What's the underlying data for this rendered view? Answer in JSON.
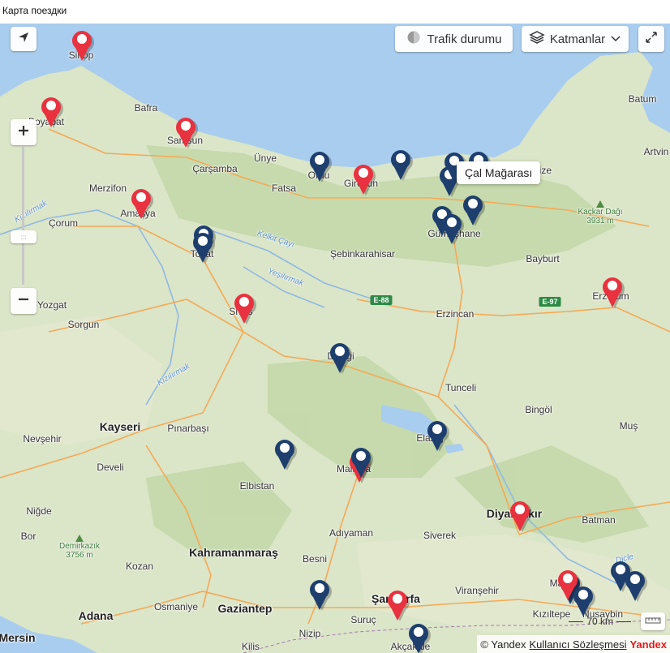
{
  "page": {
    "title": "Карта поездки"
  },
  "controls": {
    "traffic_label": "Trafik durumu",
    "layers_label": "Katmanlar",
    "scale_label": "70 km",
    "icons": [
      "navigate-arrow-icon",
      "traffic-icon",
      "layers-icon",
      "chevron-down-icon",
      "fullscreen-icon",
      "zoom-in-icon",
      "zoom-out-icon",
      "ruler-icon"
    ]
  },
  "tooltip": {
    "text": "Çal Mağarası"
  },
  "copyright": {
    "prefix": "© Yandex",
    "link": "Kullanıcı Sözleşmesi",
    "brand": "Yandex"
  },
  "cities": [
    {
      "name": "Sinop",
      "big": false
    },
    {
      "name": "Bafra",
      "big": false
    },
    {
      "name": "Boyabat",
      "big": false
    },
    {
      "name": "Samsun",
      "big": false
    },
    {
      "name": "Çarşamba",
      "big": false
    },
    {
      "name": "Ünye",
      "big": false
    },
    {
      "name": "Fatsa",
      "big": false
    },
    {
      "name": "Ordu",
      "big": false
    },
    {
      "name": "Giresun",
      "big": false
    },
    {
      "name": "Rize",
      "big": false
    },
    {
      "name": "Batum",
      "big": false
    },
    {
      "name": "Artvin",
      "big": false
    },
    {
      "name": "Merzifon",
      "big": false
    },
    {
      "name": "Çorum",
      "big": false
    },
    {
      "name": "Amasya",
      "big": false
    },
    {
      "name": "Tokat",
      "big": false
    },
    {
      "name": "Gümüşhane",
      "big": false
    },
    {
      "name": "Şebinkarahisar",
      "big": false
    },
    {
      "name": "Bayburt",
      "big": false
    },
    {
      "name": "Erzurum",
      "big": false
    },
    {
      "name": "Yozgat",
      "big": false
    },
    {
      "name": "Sorgun",
      "big": false
    },
    {
      "name": "Sivas",
      "big": false
    },
    {
      "name": "Erzincan",
      "big": false
    },
    {
      "name": "Divriği",
      "big": false
    },
    {
      "name": "Tunceli",
      "big": false
    },
    {
      "name": "Bingöl",
      "big": false
    },
    {
      "name": "Kayseri",
      "big": true
    },
    {
      "name": "Nevşehir",
      "big": false
    },
    {
      "name": "Pınarbaşı",
      "big": false
    },
    {
      "name": "Elazığ",
      "big": false
    },
    {
      "name": "Muş",
      "big": false
    },
    {
      "name": "Develi",
      "big": false
    },
    {
      "name": "Malatya",
      "big": false
    },
    {
      "name": "Elbistan",
      "big": false
    },
    {
      "name": "Niğde",
      "big": false
    },
    {
      "name": "Diyarbakır",
      "big": true
    },
    {
      "name": "Batman",
      "big": false
    },
    {
      "name": "Bor",
      "big": false
    },
    {
      "name": "Adıyaman",
      "big": false
    },
    {
      "name": "Siverek",
      "big": false
    },
    {
      "name": "Kahramanmaraş",
      "big": true
    },
    {
      "name": "Besni",
      "big": false
    },
    {
      "name": "Kozan",
      "big": false
    },
    {
      "name": "Mardin",
      "big": false
    },
    {
      "name": "Osmaniye",
      "big": false
    },
    {
      "name": "Viranşehir",
      "big": false
    },
    {
      "name": "Kızıltepe",
      "big": false
    },
    {
      "name": "Nusaybin",
      "big": false
    },
    {
      "name": "Adana",
      "big": true
    },
    {
      "name": "Gaziantep",
      "big": true
    },
    {
      "name": "Şanlıurfa",
      "big": true
    },
    {
      "name": "Suruç",
      "big": false
    },
    {
      "name": "Mersin",
      "big": true
    },
    {
      "name": "Nizip",
      "big": false
    },
    {
      "name": "Kilis",
      "big": false
    },
    {
      "name": "Akçakale",
      "big": false
    }
  ],
  "water_labels": [
    "Kızılırmak",
    "Kelkit Çayı",
    "Yeşilırmak",
    "Kızılırmak",
    "Dicle"
  ],
  "peaks": [
    {
      "name": "Kaçkar Dağı",
      "elev": "3931 m"
    },
    {
      "name": "Demirkazık",
      "elev": "3756 m"
    }
  ],
  "roads": [
    "E-88",
    "E-97"
  ],
  "colors": {
    "pin_red": "#e8323f",
    "pin_blue": "#1e3f6e",
    "sea": "#a9cdee",
    "land": "#dbe5c8"
  },
  "pins": [
    {
      "color": "red"
    },
    {
      "color": "red"
    },
    {
      "color": "red"
    },
    {
      "color": "red"
    },
    {
      "color": "blue"
    },
    {
      "color": "red"
    },
    {
      "color": "blue"
    },
    {
      "color": "blue"
    },
    {
      "color": "blue"
    },
    {
      "color": "blue"
    },
    {
      "color": "blue"
    },
    {
      "color": "blue"
    },
    {
      "color": "blue"
    },
    {
      "color": "blue"
    },
    {
      "color": "red"
    },
    {
      "color": "red"
    },
    {
      "color": "blue"
    },
    {
      "color": "blue"
    },
    {
      "color": "blue"
    },
    {
      "color": "red"
    },
    {
      "color": "blue"
    },
    {
      "color": "red"
    },
    {
      "color": "blue"
    },
    {
      "color": "red"
    },
    {
      "color": "blue"
    },
    {
      "color": "blue"
    },
    {
      "color": "blue"
    },
    {
      "color": "blue"
    },
    {
      "color": "blue"
    },
    {
      "color": "red"
    },
    {
      "color": "blue"
    }
  ]
}
